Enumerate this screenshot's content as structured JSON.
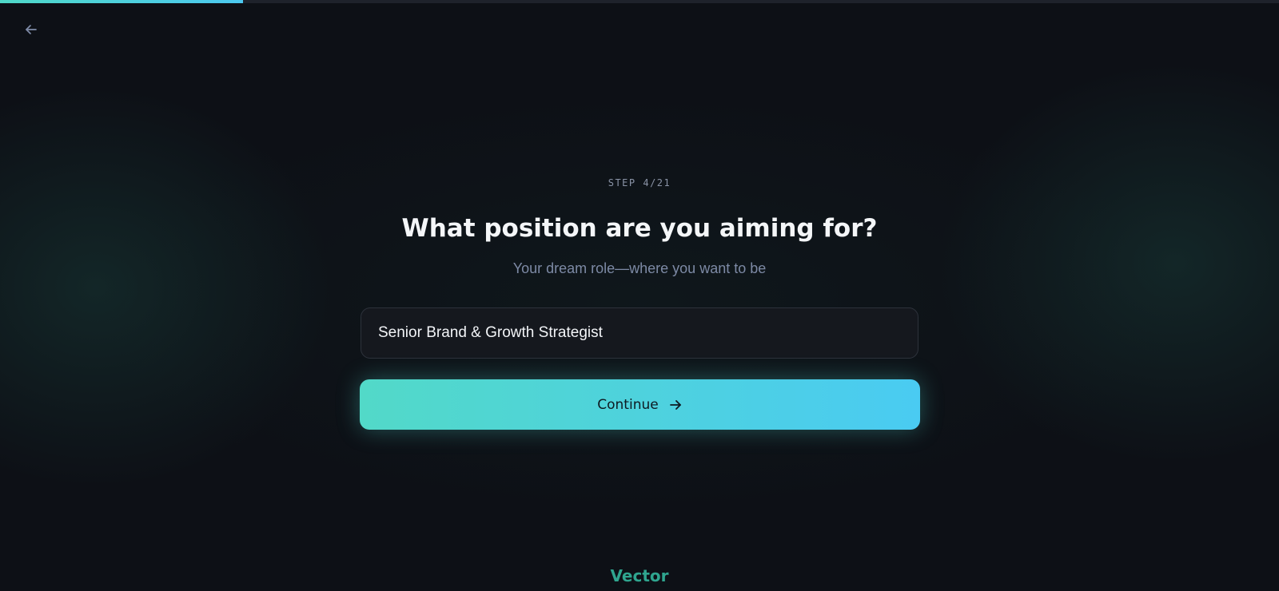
{
  "progress": {
    "fraction": 0.19,
    "fill_color": "#4fd8c8",
    "track_color": "#1e222b"
  },
  "nav": {
    "back_icon": "arrow-left-icon"
  },
  "step": {
    "label": "STEP 4/21"
  },
  "question": {
    "title": "What position are you aiming for?",
    "subtitle": "Your dream role—where you want to be"
  },
  "input": {
    "value": "Senior Brand & Growth Strategist"
  },
  "continue_button": {
    "label": "Continue",
    "icon": "arrow-right-icon",
    "gradient_start": "#52d9c8",
    "gradient_end": "#4acbf2"
  },
  "brand": {
    "name": "Vector",
    "color": "#2fa58f"
  },
  "colors": {
    "background": "#0d1016",
    "accent": "#4fd8c8"
  }
}
